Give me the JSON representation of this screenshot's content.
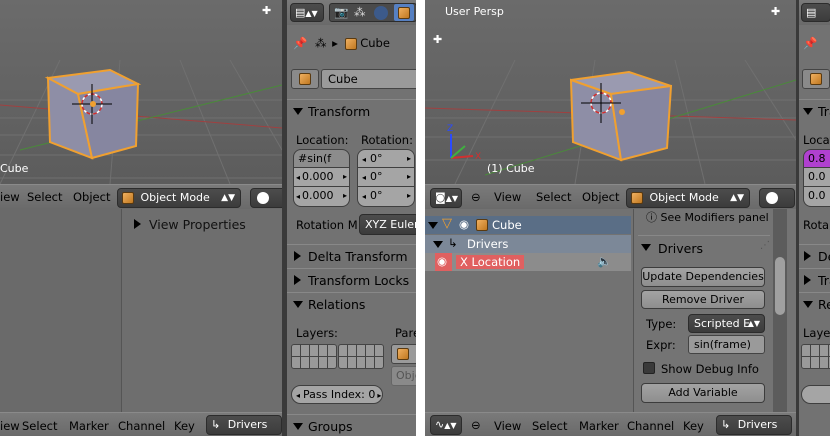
{
  "left": {
    "viewport": {
      "object_label": "Cube"
    },
    "header": {
      "view": "iew",
      "select": "Select",
      "object": "Object",
      "mode": "Object Mode"
    },
    "dope": {
      "view_properties": "View Properties"
    },
    "bottom": {
      "view": "iew",
      "select": "Select",
      "marker": "Marker",
      "channel": "Channel",
      "key": "Key",
      "editor": "Drivers"
    }
  },
  "props": {
    "breadcrumb_object": "Cube",
    "object_name": "Cube",
    "transform": {
      "title": "Transform",
      "location_label": "Location:",
      "rotation_label": "Rotation:",
      "loc": [
        "#sin(f",
        "0.000",
        "0.000"
      ],
      "rot": [
        "0°",
        "0°",
        "0°"
      ],
      "rotation_mode_label": "Rotation M",
      "rotation_mode": "XYZ Euler"
    },
    "delta_transform": "Delta Transform",
    "transform_locks": "Transform Locks",
    "relations": {
      "title": "Relations",
      "layers_label": "Layers:",
      "parent_label": "Pare",
      "parent_type": "Obje",
      "pass_index": "Pass Index: 0"
    },
    "groups": "Groups"
  },
  "right": {
    "viewport": {
      "persp_label": "User Persp",
      "object_label": "(1) Cube"
    },
    "header": {
      "view": "View",
      "select": "Select",
      "object": "Object",
      "mode": "Object Mode"
    },
    "channels": {
      "object": "Cube",
      "drivers": "Drivers",
      "x_location": "X Location"
    },
    "drivers_panel": {
      "modifiers_hint": "See Modifiers panel",
      "title": "Drivers",
      "update_deps": "Update Dependencies",
      "remove_driver": "Remove Driver",
      "type_label": "Type:",
      "type_value": "Scripted E",
      "expr_label": "Expr:",
      "expr_value": "sin(frame)",
      "show_debug": "Show Debug Info",
      "add_variable": "Add Variable"
    },
    "bottom": {
      "view": "View",
      "select": "Select",
      "marker": "Marker",
      "channel": "Channel",
      "key": "Key",
      "editor": "Drivers"
    },
    "props_peek": {
      "tra": "Tra",
      "locat": "Locat",
      "val": "0.8",
      "zero1": "0.0",
      "zero2": "0.0",
      "rota": "Rota",
      "de": "De",
      "tra2": "Tra",
      "re": "Re",
      "laye": "Laye"
    }
  },
  "colors": {
    "selection_orange": "#f0a030",
    "driver_purple": "#b040d0",
    "channel_red": "#e06060",
    "viewport_bg": "#646464"
  }
}
